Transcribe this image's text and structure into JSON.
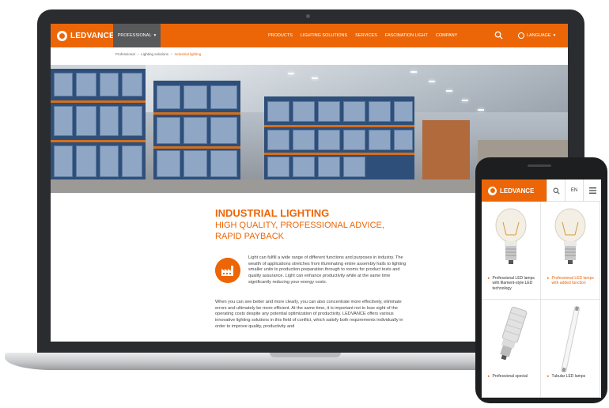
{
  "site": {
    "brand": "LEDVANCE",
    "pro_tab": "PROFESSIONAL",
    "nav": [
      "PRODUCTS",
      "LIGHTING SOLUTIONS",
      "SERVICES",
      "FASCINATION LIGHT",
      "COMPANY"
    ],
    "language": "LANGUAGE"
  },
  "breadcrumb": [
    "Professional",
    "Lighting solutions",
    "Industrial lighting"
  ],
  "content": {
    "title": "INDUSTRIAL LIGHTING",
    "subtitle": "HIGH QUALITY, PROFESSIONAL ADVICE, RAPID PAYBACK",
    "para1": "Light can fulfill a wide range of different functions and purposes in industry. The wealth of applications stretches from illuminating entire assembly halls to lighting smaller units to production preparation through to rooms for product tests and quality assurance. Light can enhance productivity while at the same time significantly reducing your energy costs.",
    "para2": "When you can see better and more clearly, you can also concentrate more effectively, eliminate errors and ultimately be more efficient. At the same time, it is important not to lose sight of the operating costs despite any potential optimization of productivity. LEDVANCE offers various innovative lighting solutions in this field of conflict, which satisfy both requirements individually in order to improve quality, productivity and"
  },
  "phone": {
    "brand": "LEDVANCE",
    "lang": "EN",
    "products": [
      {
        "label": "Professional LED lamps with filament-style LED technology",
        "highlight": false
      },
      {
        "label": "Professional LED lamps with added function",
        "highlight": true
      },
      {
        "label": "Professional special",
        "highlight": false
      },
      {
        "label": "Tubular LED lamps",
        "highlight": false
      }
    ]
  },
  "colors": {
    "accent": "#ec6608",
    "pro_tab": "#58595b",
    "device": "#2a2c2f"
  },
  "icons": [
    "search-icon",
    "globe-icon",
    "chevron-down-icon",
    "factory-icon",
    "menu-icon",
    "bulb-icon"
  ]
}
